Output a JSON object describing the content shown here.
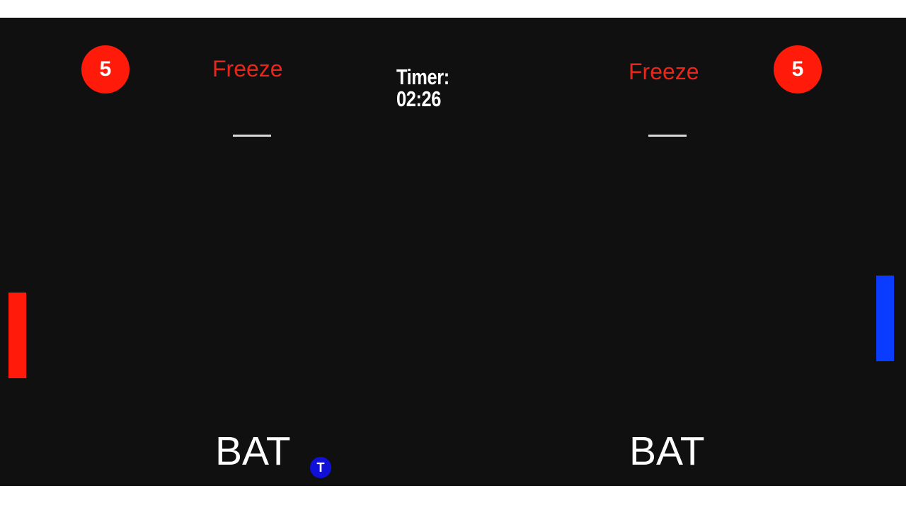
{
  "theme": {
    "board_color": "#111011",
    "red": "#ff1a0a",
    "blue": "#0a3cff",
    "token_blue": "#1010d8",
    "freeze_color": "#e8261a"
  },
  "left_player": {
    "score": "5",
    "powerup_label": "Freeze",
    "powerup_value": "—",
    "bat_label": "BAT",
    "paddle_color": "#ff1a0a"
  },
  "right_player": {
    "score": "5",
    "powerup_label": "Freeze",
    "powerup_value": "—",
    "bat_label": "BAT",
    "paddle_color": "#0a3cff"
  },
  "timer": {
    "text": "Timer: 02:26"
  },
  "token": {
    "letter": "T"
  }
}
